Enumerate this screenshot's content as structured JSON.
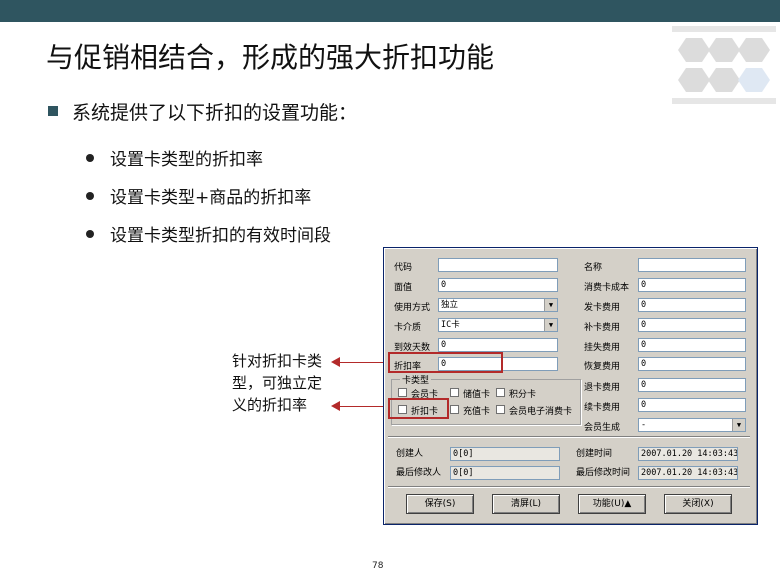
{
  "slide": {
    "title": "与促销相结合，形成的强大折扣功能",
    "main_bullet": "系统提供了以下折扣的设置功能：",
    "sub_bullets": [
      "设置卡类型的折扣率",
      "设置卡类型+商品的折扣率",
      "设置卡类型折扣的有效时间段"
    ],
    "note": "针对折扣卡类型，可独立定义的折扣率",
    "page_number": "78"
  },
  "colors": {
    "topbar": "#2f5560",
    "highlight": "#b32a2a",
    "dialog_bg": "#d4d0c8"
  },
  "dialog": {
    "left_fields": [
      {
        "label": "代码",
        "value": ""
      },
      {
        "label": "面值",
        "value": "0"
      },
      {
        "label": "使用方式",
        "value": "独立"
      },
      {
        "label": "卡介质",
        "value": "IC卡"
      },
      {
        "label": "到效天数",
        "value": "0"
      },
      {
        "label": "折扣率",
        "value": "0"
      }
    ],
    "right_fields": [
      {
        "label": "名称",
        "value": ""
      },
      {
        "label": "消费卡成本",
        "value": "0"
      },
      {
        "label": "发卡费用",
        "value": "0"
      },
      {
        "label": "补卡费用",
        "value": "0"
      },
      {
        "label": "挂失费用",
        "value": "0"
      },
      {
        "label": "恢复费用",
        "value": "0"
      },
      {
        "label": "退卡费用",
        "value": "0"
      },
      {
        "label": "续卡费用",
        "value": "0"
      },
      {
        "label": "会员生成",
        "value": "-"
      }
    ],
    "card_type_group": {
      "title": "卡类型",
      "options": [
        "会员卡",
        "储值卡",
        "积分卡",
        "折扣卡",
        "充值卡",
        "会员电子消费卡"
      ]
    },
    "audit": {
      "creator_label": "创建人",
      "creator_value": "0[0]",
      "modifier_label": "最后修改人",
      "modifier_value": "0[0]",
      "created_label": "创建时间",
      "created_value": "2007.01.20 14:03:43",
      "modified_label": "最后修改时间",
      "modified_value": "2007.01.20 14:03:43"
    },
    "buttons": [
      "保存(S)",
      "清屏(L)",
      "功能(U)▲",
      "关闭(X)"
    ]
  }
}
